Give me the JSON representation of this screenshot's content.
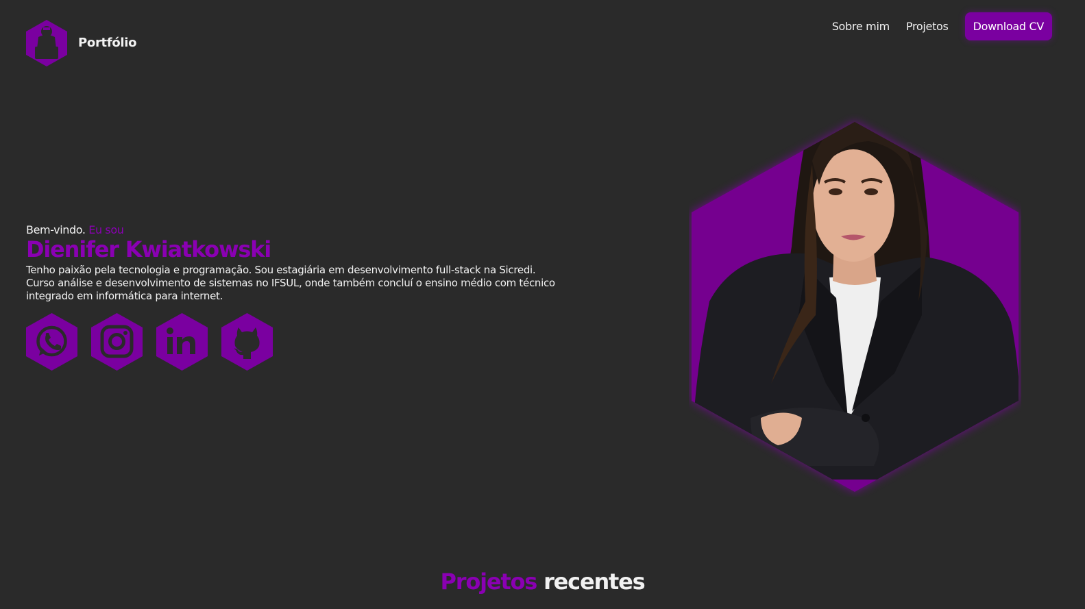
{
  "header": {
    "brand": "Portfólio",
    "nav": [
      {
        "label": "Sobre mim"
      },
      {
        "label": "Projetos"
      }
    ],
    "cta_label": "Download CV"
  },
  "hero": {
    "greeting": "Bem-vindo.",
    "greeting_accent": "Eu sou",
    "name": "Dienifer Kwiatkowski",
    "description": "Tenho paixão pela tecnologia e programação. Sou estagiária em desenvolvimento full-stack na Sicredi. Curso análise e desenvolvimento de sistemas no IFSUL, onde também concluí o ensino médio com técnico integrado em informática para internet."
  },
  "socials": [
    {
      "icon": "whatsapp-icon"
    },
    {
      "icon": "instagram-icon"
    },
    {
      "icon": "linkedin-icon"
    },
    {
      "icon": "github-icon"
    }
  ],
  "section": {
    "title_accent": "Projetos",
    "title_rest": "recentes"
  },
  "colors": {
    "background": "#2a2a2a",
    "accent": "#8a00b3",
    "button": "#7a00a0",
    "text": "#f2f2f2"
  }
}
